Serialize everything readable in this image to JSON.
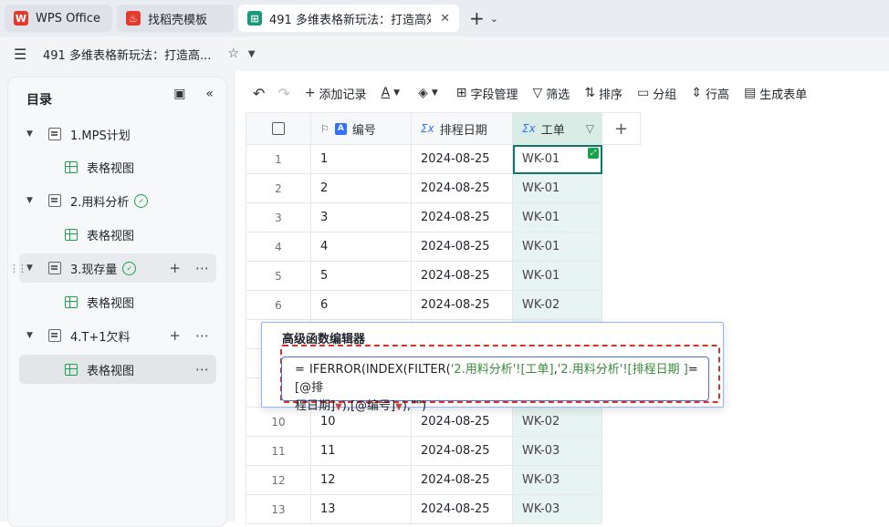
{
  "tabs": [
    {
      "label": "WPS Office",
      "icon": "wps-logo-icon",
      "color": "#e23b2e"
    },
    {
      "label": "找稻壳模板",
      "icon": "docer-logo-icon",
      "color": "#e23b2e"
    },
    {
      "label": "491 多维表格新玩法：打造高效自",
      "icon": "multidim-table-icon",
      "color": "#1a9a7b",
      "active": true
    }
  ],
  "header": {
    "doc_title": "491 多维表格新玩法：打造高..."
  },
  "sidebar": {
    "title": "目录",
    "items": [
      {
        "label": "1.MPS计划",
        "type": "sheet"
      },
      {
        "label": "表格视图",
        "type": "view"
      },
      {
        "label": "2.用料分析",
        "type": "sheet",
        "status": "synced"
      },
      {
        "label": "表格视图",
        "type": "view"
      },
      {
        "label": "3.现存量",
        "type": "sheet",
        "status": "synced"
      },
      {
        "label": "表格视图",
        "type": "view"
      },
      {
        "label": "4.T+1欠料",
        "type": "sheet"
      },
      {
        "label": "表格视图",
        "type": "view",
        "selected": true
      }
    ]
  },
  "toolbar": {
    "add_record": "添加记录",
    "field_manage": "字段管理",
    "filter": "筛选",
    "sort": "排序",
    "group": "分组",
    "row_height": "行高",
    "gen_form": "生成表单"
  },
  "grid": {
    "columns": [
      {
        "label": "编号",
        "type": "text"
      },
      {
        "label": "排程日期",
        "type": "formula"
      },
      {
        "label": "工单",
        "type": "formula"
      }
    ],
    "rows": [
      {
        "n": "1",
        "id": "1",
        "date": "2024-08-25",
        "wo": "WK-01"
      },
      {
        "n": "2",
        "id": "2",
        "date": "2024-08-25",
        "wo": "WK-01"
      },
      {
        "n": "3",
        "id": "3",
        "date": "2024-08-25",
        "wo": "WK-01"
      },
      {
        "n": "4",
        "id": "4",
        "date": "2024-08-25",
        "wo": "WK-01"
      },
      {
        "n": "5",
        "id": "5",
        "date": "2024-08-25",
        "wo": "WK-01"
      },
      {
        "n": "6",
        "id": "6",
        "date": "2024-08-25",
        "wo": "WK-02"
      },
      {
        "n": "",
        "id": "",
        "date": "",
        "wo": ""
      },
      {
        "n": "",
        "id": "",
        "date": "",
        "wo": ""
      },
      {
        "n": "",
        "id": "",
        "date": "",
        "wo": ""
      },
      {
        "n": "10",
        "id": "10",
        "date": "2024-08-25",
        "wo": "WK-02"
      },
      {
        "n": "11",
        "id": "11",
        "date": "2024-08-25",
        "wo": "WK-03"
      },
      {
        "n": "12",
        "id": "12",
        "date": "2024-08-25",
        "wo": "WK-03"
      },
      {
        "n": "13",
        "id": "13",
        "date": "2024-08-25",
        "wo": "WK-03"
      }
    ]
  },
  "formula_editor": {
    "title": "高级函数编辑器",
    "eq": "=",
    "f_part1": "IFERROR(INDEX(FILTER(",
    "ref1": "'2.用料分析'![工单]",
    "comma1": ",",
    "ref2": "'2.用料分析'![排程日期 ]",
    "f_part2": "=[@排",
    "f_part3": "程日期]",
    "f_part4": "),[@编号]",
    "f_part5": "),\"\")"
  }
}
